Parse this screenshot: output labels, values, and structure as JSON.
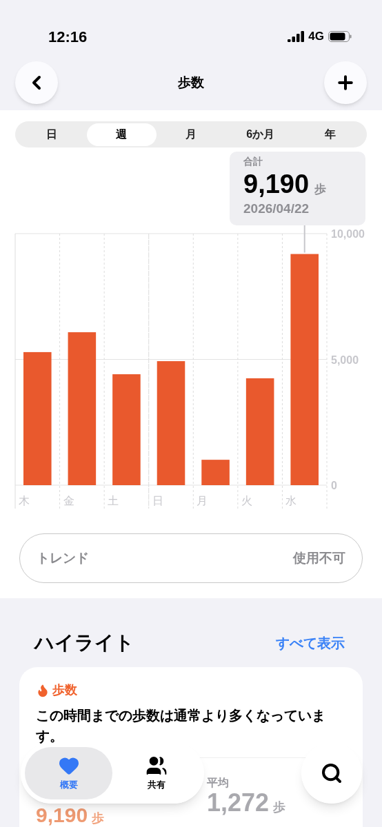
{
  "status_bar": {
    "time": "12:16",
    "network": "4G"
  },
  "nav": {
    "title": "歩数"
  },
  "range_tabs": [
    {
      "label": "日",
      "selected": false
    },
    {
      "label": "週",
      "selected": true
    },
    {
      "label": "月",
      "selected": false
    },
    {
      "label": "6か月",
      "selected": false
    },
    {
      "label": "年",
      "selected": false
    }
  ],
  "summary": {
    "label": "合計",
    "value": "9,190",
    "unit": "歩",
    "date": "2026/04/22"
  },
  "chart": {
    "chart_data": {
      "type": "bar",
      "categories": [
        "木",
        "金",
        "土",
        "日",
        "月",
        "火",
        "水"
      ],
      "series": [
        {
          "color": "#e9592d",
          "values": [
            5290,
            6080,
            4410,
            4930,
            1010,
            4250,
            9190
          ]
        }
      ],
      "ylim": [
        0,
        10000
      ],
      "yticks": [
        {
          "value": 0,
          "label": "0"
        },
        {
          "value": 5000,
          "label": "5,000"
        },
        {
          "value": 10000,
          "label": "10,000"
        }
      ]
    }
  },
  "trend": {
    "label": "トレンド",
    "value": "使用不可"
  },
  "highlights": {
    "title": "ハイライト",
    "link": "すべて表示",
    "card": {
      "category": "歩数",
      "text": "この時間までの歩数は通常より多くなっています。",
      "stats": [
        {
          "label": "平均",
          "value": "1,272",
          "unit": "歩"
        }
      ],
      "today": {
        "value": "9,190",
        "unit": "歩"
      }
    }
  },
  "tab_bar": [
    {
      "label": "概要",
      "selected": true,
      "kind": "heart"
    },
    {
      "label": "共有",
      "selected": false,
      "kind": "people"
    }
  ]
}
